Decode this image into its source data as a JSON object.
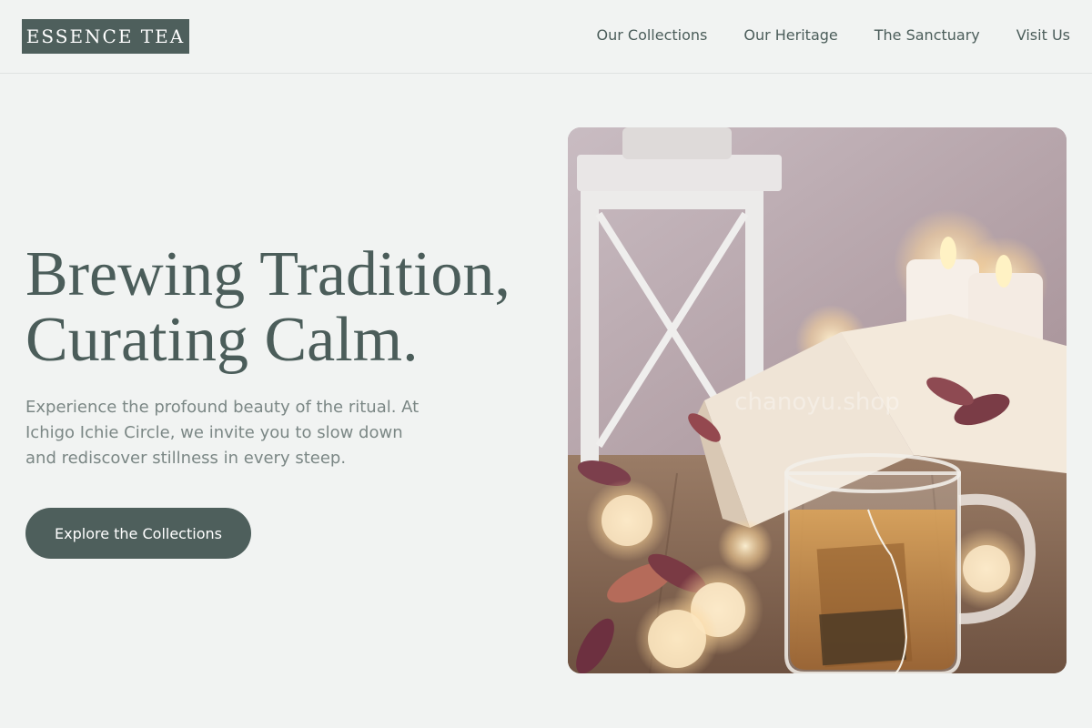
{
  "brand": {
    "logo_text": "ESSENCE TEA"
  },
  "nav": {
    "items": [
      {
        "label": "Our Collections"
      },
      {
        "label": "Our Heritage"
      },
      {
        "label": "The Sanctuary"
      },
      {
        "label": "Visit Us"
      }
    ]
  },
  "hero": {
    "title_line1": "Brewing Tradition,",
    "title_line2": "Curating Calm.",
    "description": "Experience the profound beauty of the ritual. At Ichigo Ichie Circle, we invite you to slow down and rediscover stillness in every steep.",
    "cta_label": "Explore the Collections",
    "image_watermark": "chanoyu.shop"
  },
  "colors": {
    "background": "#f1f3f2",
    "accent": "#4e5f5c",
    "text_primary": "#4b5d5a",
    "text_muted": "#7b8785"
  }
}
